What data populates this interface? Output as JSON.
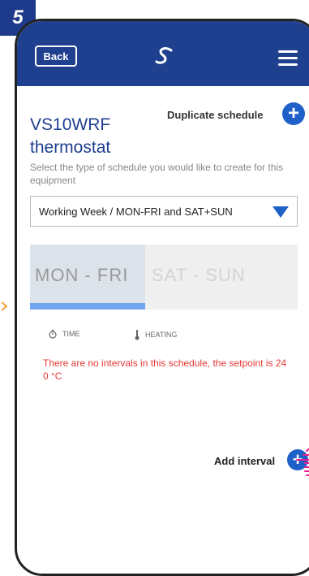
{
  "step_badge": "5",
  "header": {
    "back_label": "Back",
    "logo_icon": "s-logo-icon",
    "menu_icon": "hamburger-menu-icon"
  },
  "duplicate": {
    "label": "Duplicate schedule",
    "button_glyph": "+"
  },
  "device_title": "VS10WRF thermostat",
  "subtitle": "Select the type of schedule you would like to create for this equipment",
  "schedule_select": {
    "value": "Working Week / MON-FRI and SAT+SUN"
  },
  "tabs": [
    {
      "label": "MON - FRI",
      "active": true
    },
    {
      "label": "SAT - SUN",
      "active": false
    }
  ],
  "columns": {
    "time": "TIME",
    "heating": "HEATING"
  },
  "empty_message": "There are no intervals in this schedule, the setpoint is 24 0 °C",
  "add_interval": {
    "label": "Add interval",
    "button_glyph": "+"
  },
  "colors": {
    "brand_blue": "#1f3f8f",
    "accent_blue": "#1f5fc8",
    "error_red": "#e53935",
    "hand_pink": "#e91e8c"
  }
}
